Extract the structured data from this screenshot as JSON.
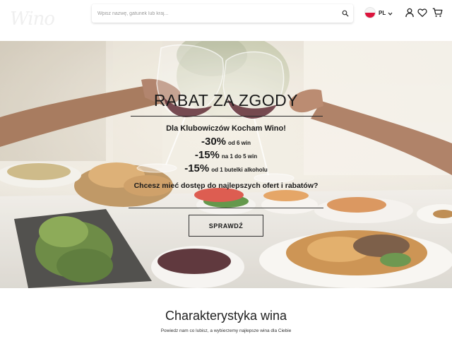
{
  "header": {
    "logo_text": "Wino",
    "search": {
      "placeholder": "Wpisz nazwę, gatunek lub kraj...",
      "value": ""
    },
    "language": {
      "code": "PL"
    },
    "icons": [
      "search-icon",
      "poland-flag-icon",
      "chevron-down-icon",
      "user-icon",
      "heart-icon",
      "cart-icon"
    ]
  },
  "hero": {
    "title": "RABAT ZA ZGODY",
    "subtitle": "Dla Klubowiczów Kocham Wino!",
    "offers": [
      {
        "percent": "-30%",
        "text": "od 6 win"
      },
      {
        "percent": "-15%",
        "text": "na 1 do 5 win"
      },
      {
        "percent": "-15%",
        "text": "od 1 butelki alkoholu"
      }
    ],
    "question": "Chcesz mieć dostęp do najlepszych ofert i rabatów?",
    "cta_label": "SPRAWDŹ"
  },
  "section": {
    "title": "Charakterystyka wina",
    "subtitle": "Powiedz nam co lubisz, a wybierzemy najlepsze wina dla Ciebie"
  },
  "colors": {
    "flag_white": "#f4f4f4",
    "flag_red": "#dc143c",
    "text_dark": "#1a1a1a"
  }
}
